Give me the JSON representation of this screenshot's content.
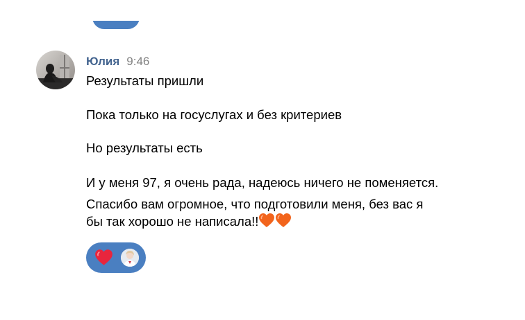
{
  "message": {
    "author": "Юлия",
    "time": "9:46",
    "paragraphs": [
      "Результаты пришли",
      "Пока только на госуслугах и без критериев",
      "Но результаты есть"
    ],
    "last_paragraph_lines": [
      "И у меня 97, я очень рада, надеюсь ничего не поменяется.",
      "Спасибо вам огромное, что подготовили меня, без вас я",
      "бы так хорошо не написала!!"
    ],
    "trailing_emoji": [
      "orange-heart",
      "orange-heart"
    ]
  },
  "reactions": {
    "emoji": "red-heart",
    "reactor_avatar": "reactor-avatar"
  },
  "colors": {
    "author": "#43648f",
    "timestamp": "#828282",
    "reaction_pill": "#4a7fc1",
    "red_heart": "#e8253d",
    "orange_heart": "#f2641c"
  }
}
